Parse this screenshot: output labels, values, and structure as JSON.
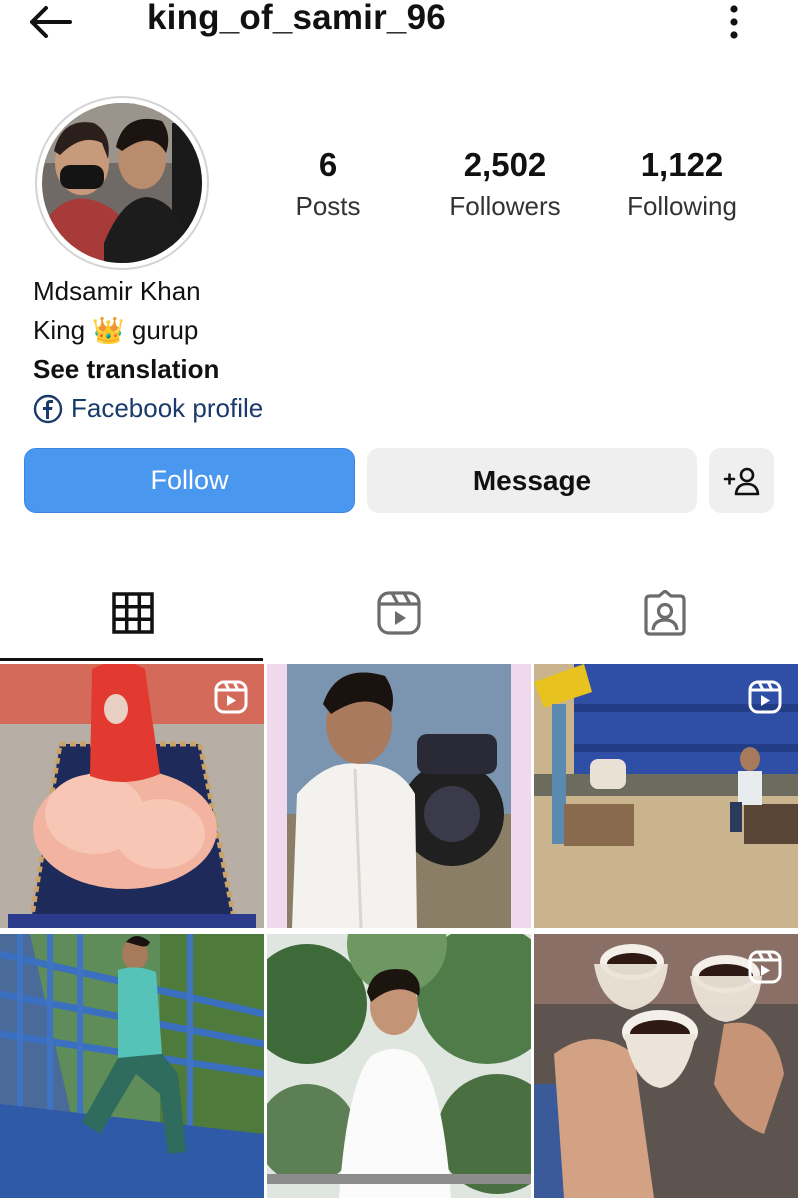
{
  "header": {
    "username": "king_of_samir_96",
    "back_icon": "arrow-left-icon",
    "menu_icon": "more-vertical-icon"
  },
  "stats": {
    "posts_count": "6",
    "posts_label": "Posts",
    "followers_count": "2,502",
    "followers_label": "Followers",
    "following_count": "1,122",
    "following_label": "Following"
  },
  "bio": {
    "name": "Mdsamir Khan",
    "line_prefix": "King",
    "line_emoji": "👑",
    "line_suffix": "gurup",
    "see_translation": "See translation",
    "facebook_link": "Facebook profile"
  },
  "actions": {
    "follow_label": "Follow",
    "message_label": "Message",
    "add_user_icon": "add-user-icon"
  },
  "tabs": [
    {
      "name": "posts-grid",
      "icon": "grid-icon",
      "active": true
    },
    {
      "name": "reels",
      "icon": "reels-icon",
      "active": false
    },
    {
      "name": "tagged",
      "icon": "tagged-icon",
      "active": false
    }
  ],
  "colors": {
    "follow_button": "#4a97f0",
    "secondary_button": "#efefef",
    "link_text": "#1a3a6b"
  },
  "posts": [
    {
      "type": "reel"
    },
    {
      "type": "photo"
    },
    {
      "type": "reel"
    },
    {
      "type": "photo"
    },
    {
      "type": "photo"
    },
    {
      "type": "reel"
    }
  ]
}
